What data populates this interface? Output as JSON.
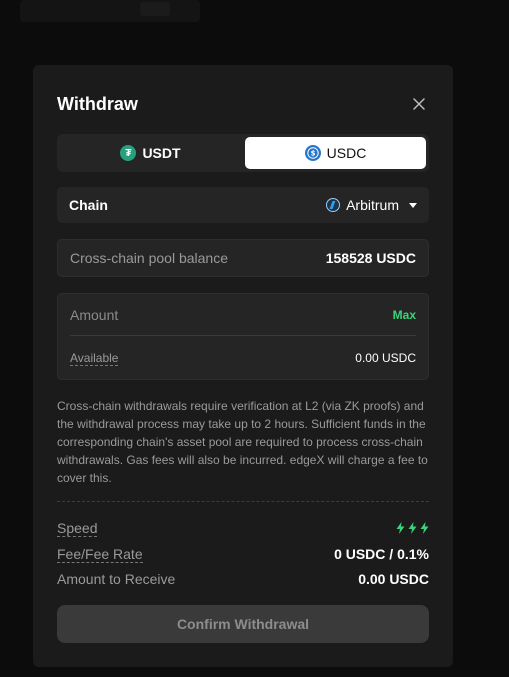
{
  "modal": {
    "title": "Withdraw",
    "tabs": [
      {
        "label": "USDT",
        "icon": "tether-icon",
        "active": false
      },
      {
        "label": "USDC",
        "icon": "usdc-icon",
        "active": true
      }
    ],
    "chain": {
      "label": "Chain",
      "selected": "Arbitrum",
      "icon": "arbitrum-icon"
    },
    "pool": {
      "label": "Cross-chain pool balance",
      "value": "158528 USDC"
    },
    "amount": {
      "placeholder": "Amount",
      "max_label": "Max",
      "available_label": "Available",
      "available_value": "0.00 USDC"
    },
    "notice": "Cross-chain withdrawals require verification at L2 (via ZK proofs) and the withdrawal process may take up to 2 hours. Sufficient funds in the corresponding chain's asset pool are required to process cross-chain withdrawals. Gas fees will also be incurred. edgeX will charge a fee to cover this.",
    "info": {
      "speed_label": "Speed",
      "speed_level": 3,
      "fee_label": "Fee/Fee Rate",
      "fee_value": "0 USDC / 0.1%",
      "receive_label": "Amount to Receive",
      "receive_value": "0.00 USDC"
    },
    "confirm_label": "Confirm Withdrawal"
  },
  "colors": {
    "modal_bg": "#1b1b1b",
    "field_bg": "#252525",
    "accent_green": "#3bd37a",
    "usdt_green": "#26a17b",
    "usdc_blue": "#2775ca",
    "muted_text": "#9a9a9a",
    "disabled_button": "#3a3a3a"
  }
}
